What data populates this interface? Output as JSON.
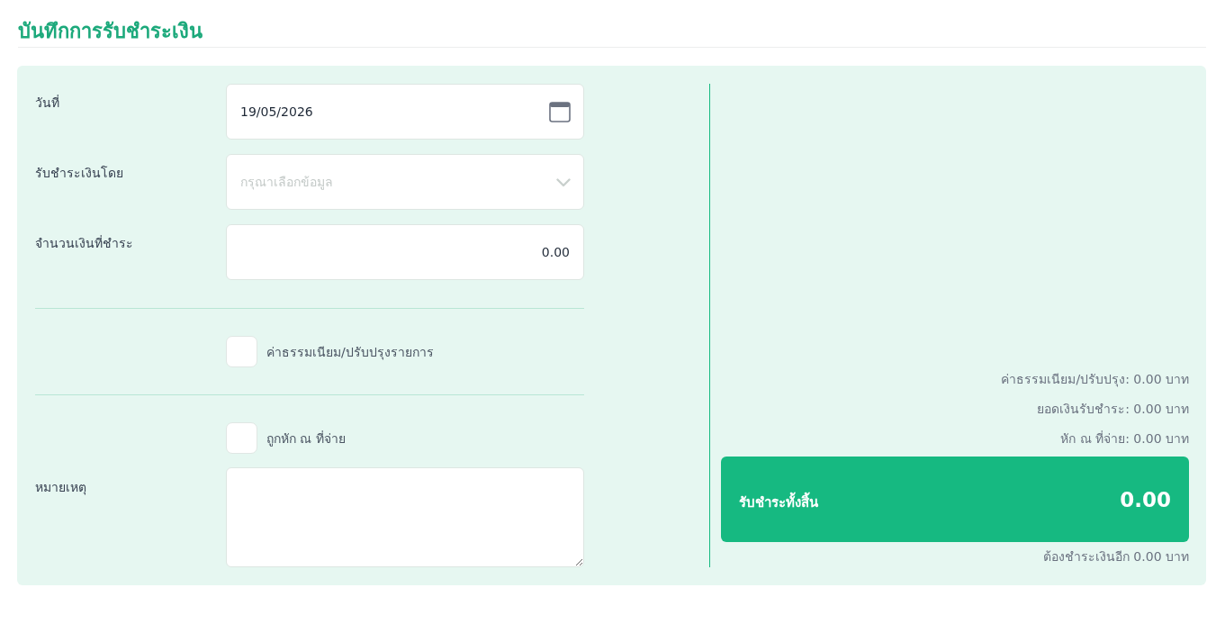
{
  "page": {
    "title": "บันทึกการรับชำระเงิน"
  },
  "form": {
    "fields": [
      {
        "kind": "date",
        "label": "วันที่",
        "value": "19/05/2026"
      },
      {
        "kind": "select",
        "label": "รับชำระเงินโดย",
        "placeholder": "กรุณาเลือกข้อมูล"
      },
      {
        "kind": "number",
        "label": "จำนวนเงินที่ชำระ",
        "value": "0.00"
      }
    ],
    "options": [
      {
        "label": "ค่าธรรมเนียม/ปรับปรุงรายการ",
        "checked": false
      },
      {
        "label": "ถูกหัก ณ ที่จ่าย",
        "checked": false
      }
    ],
    "note": {
      "label": "หมายเหตุ"
    }
  },
  "summary": {
    "lines": [
      "ค่าธรรมเนียม/ปรับปรุง: 0.00 บาท",
      "ยอดเงินรับชำระ: 0.00 บาท",
      "หัก ณ ที่จ่าย: 0.00 บาท"
    ],
    "total": {
      "label": "รับชำระทั้งสิ้น",
      "value": "0.00"
    },
    "remaining": "ต้องชำระเงินอีก 0.00 บาท"
  }
}
